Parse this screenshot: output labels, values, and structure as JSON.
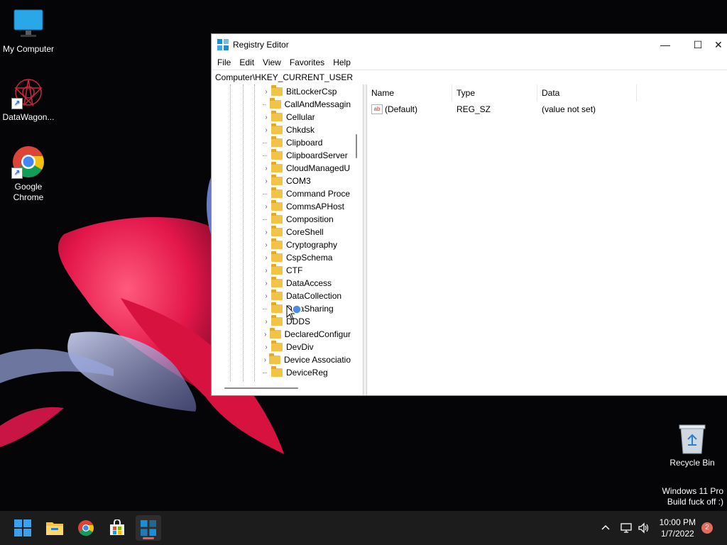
{
  "desktop": {
    "icons": [
      {
        "label": "My Computer"
      },
      {
        "label": "DataWagon..."
      },
      {
        "label": "Google Chrome"
      }
    ],
    "recycle_bin": "Recycle Bin",
    "watermark": {
      "line1": "Windows 11 Pro",
      "line2": "Build fuck off :)"
    }
  },
  "window": {
    "title": "Registry Editor",
    "controls": {
      "minimize": "—",
      "maximize": "☐",
      "close": "✕"
    },
    "menu": [
      "File",
      "Edit",
      "View",
      "Favorites",
      "Help"
    ],
    "address": "Computer\\HKEY_CURRENT_USER",
    "tree": [
      {
        "label": "BitLockerCsp",
        "expand": true
      },
      {
        "label": "CallAndMessagin",
        "expand": false
      },
      {
        "label": "Cellular",
        "expand": true
      },
      {
        "label": "Chkdsk",
        "expand": true
      },
      {
        "label": "Clipboard",
        "expand": false
      },
      {
        "label": "ClipboardServer",
        "expand": false
      },
      {
        "label": "CloudManagedU",
        "expand": true
      },
      {
        "label": "COM3",
        "expand": true
      },
      {
        "label": "Command Proce",
        "expand": false
      },
      {
        "label": "CommsAPHost",
        "expand": true
      },
      {
        "label": "Composition",
        "expand": false
      },
      {
        "label": "CoreShell",
        "expand": true
      },
      {
        "label": "Cryptography",
        "expand": true
      },
      {
        "label": "CspSchema",
        "expand": true
      },
      {
        "label": "CTF",
        "expand": true
      },
      {
        "label": "DataAccess",
        "expand": true
      },
      {
        "label": "DataCollection",
        "expand": true
      },
      {
        "label": "DataSharing",
        "expand": false
      },
      {
        "label": "DDDS",
        "expand": true
      },
      {
        "label": "DeclaredConfigur",
        "expand": true
      },
      {
        "label": "DevDiv",
        "expand": true
      },
      {
        "label": "Device Associatio",
        "expand": true
      },
      {
        "label": "DeviceReg",
        "expand": false
      }
    ],
    "list": {
      "columns": [
        "Name",
        "Type",
        "Data"
      ],
      "rows": [
        {
          "name": "(Default)",
          "type": "REG_SZ",
          "data": "(value not set)"
        }
      ]
    }
  },
  "taskbar": {
    "time": "10:00 PM",
    "date": "1/7/2022",
    "notification_count": "2"
  },
  "colors": {
    "accent": "#0078d4",
    "folder": "#f1c346",
    "badge": "#e06c5e"
  }
}
